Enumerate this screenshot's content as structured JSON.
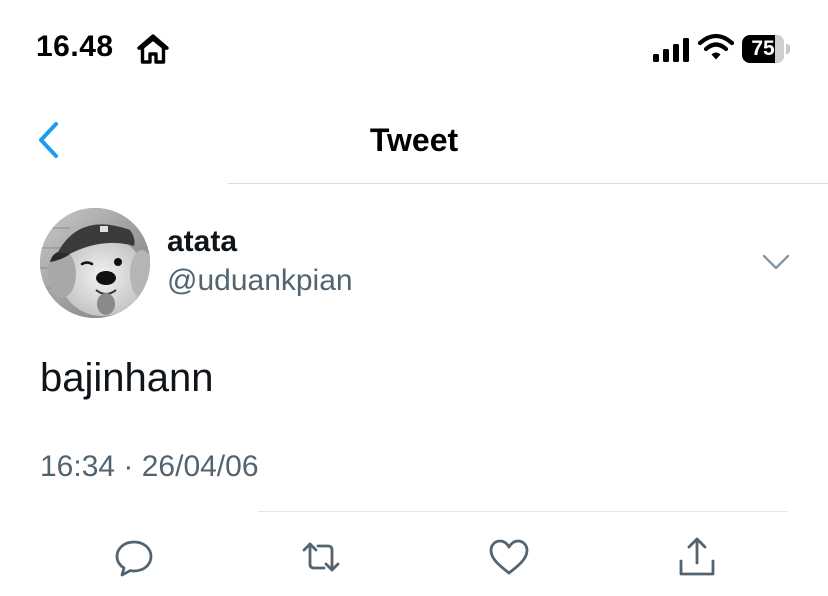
{
  "status_bar": {
    "time": "16.48",
    "battery_level": "75"
  },
  "nav": {
    "title": "Tweet"
  },
  "tweet": {
    "display_name": "atata",
    "username": "@uduankpian",
    "text": "bajinhann",
    "timestamp": "16:34 · 26/04/06"
  },
  "icons": {
    "status": [
      "home-icon",
      "cellular-signal-icon",
      "wifi-icon",
      "battery-icon"
    ],
    "nav": [
      "back-chevron-icon"
    ],
    "tweet": [
      "chevron-down-icon"
    ],
    "actions": [
      "reply-icon",
      "retweet-icon",
      "like-heart-icon",
      "share-icon"
    ]
  },
  "colors": {
    "accent": "#1d9bf0",
    "secondary_text": "#536471",
    "primary_text": "#0f1419",
    "action_icon": "#536471"
  }
}
